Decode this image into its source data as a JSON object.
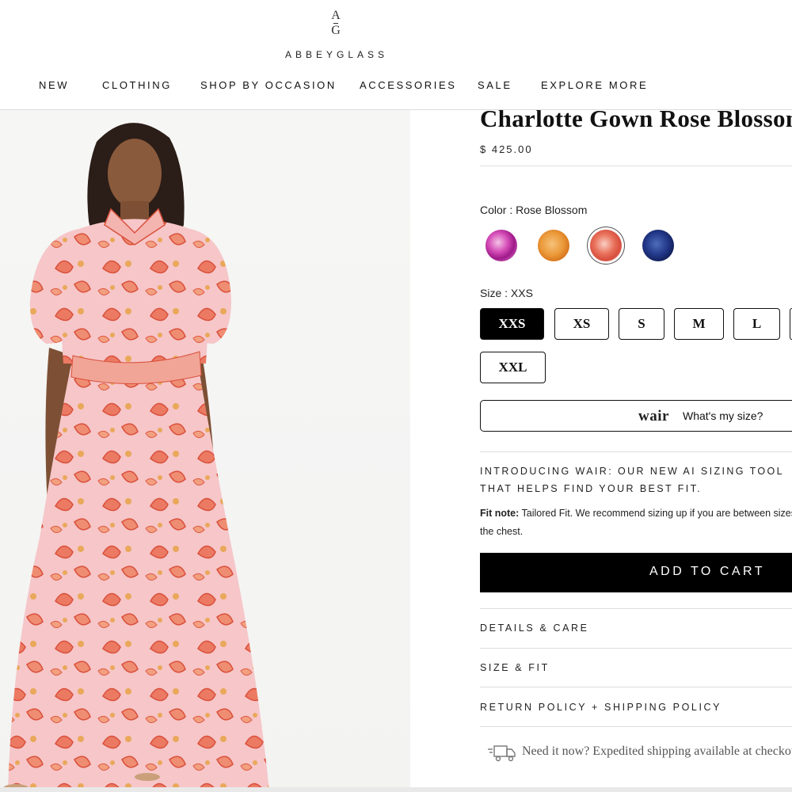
{
  "brand": {
    "mark_top": "A",
    "mark_bottom": "G",
    "name": "ABBEYGLASS"
  },
  "nav": [
    "NEW",
    "CLOTHING",
    "SHOP BY OCCASION",
    "ACCESSORIES",
    "SALE",
    "EXPLORE MORE"
  ],
  "product": {
    "title": "Charlotte Gown Rose Blossom",
    "price": "$ 425.00",
    "color_label": "Color : Rose Blossom",
    "swatches": [
      "pink-floral",
      "orange-floral",
      "rose-blossom",
      "navy-floral"
    ],
    "swatch_colors": [
      "#d64fb9",
      "#eb9a3a",
      "#e9725c",
      "#23388a"
    ],
    "selected_swatch": "rose-blossom",
    "size_label": "Size : XXS",
    "sizes": [
      "XXS",
      "XS",
      "S",
      "M",
      "L",
      "XXL"
    ],
    "selected_size": "XXS"
  },
  "wair": {
    "logo": "wair",
    "text": "What's my size?"
  },
  "intro_text": "INTRODUCING WAIR: OUR NEW AI SIZING TOOL THAT HELPS FIND YOUR BEST FIT.",
  "fit_note": {
    "label": "Fit note:",
    "text": " Tailored Fit. We recommend sizing up if you are between sizes in the chest."
  },
  "cart_label": "ADD TO CART",
  "accordions": [
    "DETAILS & CARE",
    "SIZE & FIT",
    "RETURN POLICY + SHIPPING POLICY"
  ],
  "shipping_text": "Need it now? Expedited shipping available at checkout."
}
